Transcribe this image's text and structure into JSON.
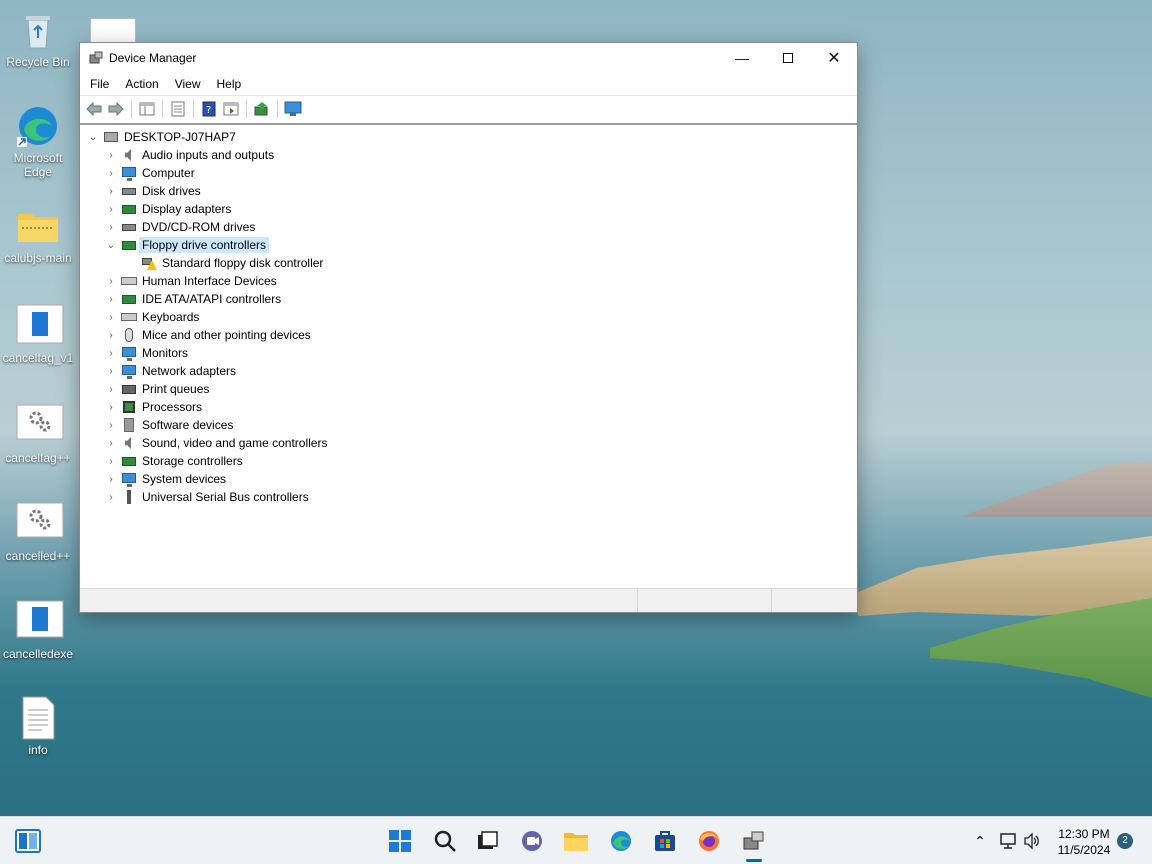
{
  "desktop": {
    "icons": [
      {
        "label": "Recycle Bin"
      },
      {
        "label": "Microsoft Edge"
      },
      {
        "label": "calubjs-main"
      },
      {
        "label": "cancelfag_v1"
      },
      {
        "label": "cancelfag++"
      },
      {
        "label": "cancelled++"
      },
      {
        "label": "cancelledexe"
      },
      {
        "label": "info"
      }
    ]
  },
  "window": {
    "title": "Device Manager",
    "menu": [
      "File",
      "Action",
      "View",
      "Help"
    ],
    "tree": {
      "root": "DESKTOP-J07HAP7",
      "categories": [
        "Audio inputs and outputs",
        "Computer",
        "Disk drives",
        "Display adapters",
        "DVD/CD-ROM drives",
        "Floppy drive controllers",
        "Standard floppy disk controller",
        "Human Interface Devices",
        "IDE ATA/ATAPI controllers",
        "Keyboards",
        "Mice and other pointing devices",
        "Monitors",
        "Network adapters",
        "Print queues",
        "Processors",
        "Software devices",
        "Sound, video and game controllers",
        "Storage controllers",
        "System devices",
        "Universal Serial Bus controllers"
      ]
    }
  },
  "taskbar": {
    "time": "12:30 PM",
    "date": "11/5/2024",
    "notification_count": "2"
  },
  "colors": {
    "selection": "#cce8ff",
    "accent": "#0067c0"
  }
}
